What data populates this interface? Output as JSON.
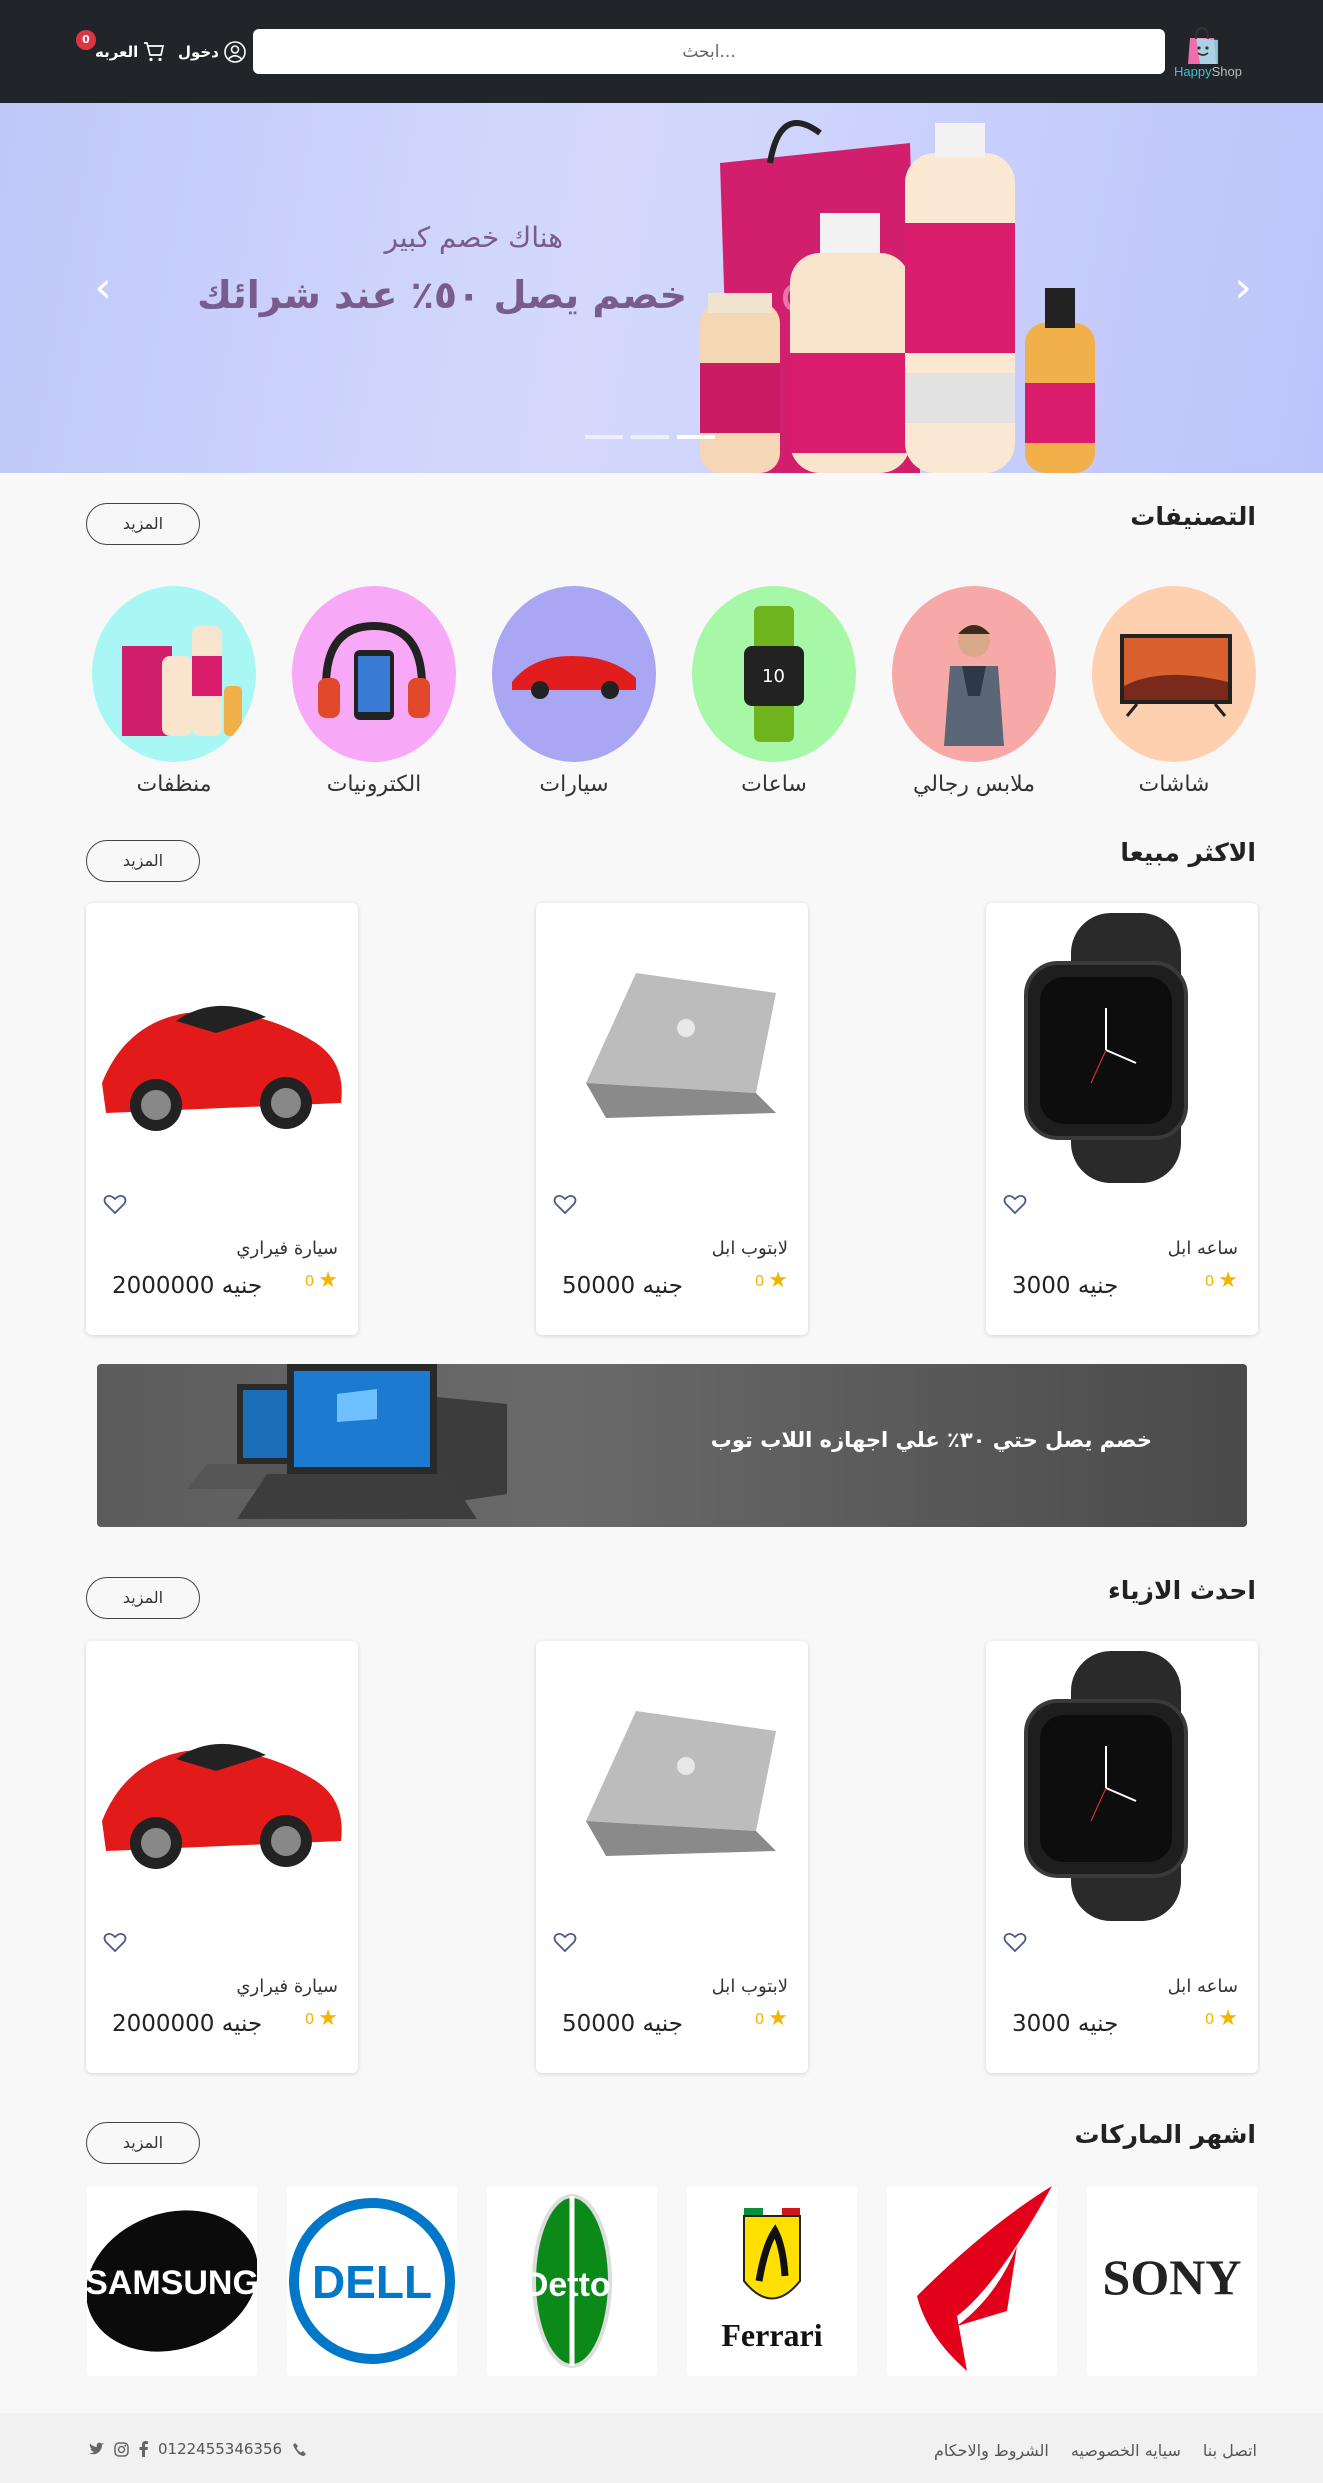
{
  "header": {
    "brand_part1": "Happy",
    "brand_part2": "Shop",
    "search_placeholder": "ابحث...",
    "login_label": "دخول",
    "cart_label": "العربه",
    "cart_count": "0"
  },
  "hero": {
    "subtitle": "هناك خصم كبير",
    "title": "خصم يصل ٥٠٪ عند شرائك",
    "slides_total": 3,
    "active_slide": 3
  },
  "categories": {
    "title": "التصنيفات",
    "more_label": "المزيد",
    "items": [
      {
        "label": "شاشات",
        "color": "#ffd0b0"
      },
      {
        "label": "ملابس رجالي",
        "color": "#f7a9a8"
      },
      {
        "label": "ساعات",
        "color": "#a6f7a6"
      },
      {
        "label": "سيارات",
        "color": "#a9a6f4"
      },
      {
        "label": "الكترونيات",
        "color": "#f7a9f7"
      },
      {
        "label": "منظفات",
        "color": "#a9f7f4"
      }
    ]
  },
  "best_sellers": {
    "title": "الاكثر مبيعا",
    "more_label": "المزيد",
    "products": [
      {
        "name": "ساعه ابل",
        "rating": "0",
        "price": "3000",
        "currency": "جنيه",
        "icon": "watch"
      },
      {
        "name": "لابتوب ابل",
        "rating": "0",
        "price": "50000",
        "currency": "جنيه",
        "icon": "laptop"
      },
      {
        "name": "سيارة فيراري",
        "rating": "0",
        "price": "2000000",
        "currency": "جنيه",
        "icon": "car"
      }
    ]
  },
  "promo": {
    "text": "خصم يصل حتي ٣٠٪ علي اجهازه اللاب توب"
  },
  "latest_fashion": {
    "title": "احدث الازياء",
    "more_label": "المزيد",
    "products": [
      {
        "name": "ساعه ابل",
        "rating": "0",
        "price": "3000",
        "currency": "جنيه",
        "icon": "watch"
      },
      {
        "name": "لابتوب ابل",
        "rating": "0",
        "price": "50000",
        "currency": "جنيه",
        "icon": "laptop"
      },
      {
        "name": "سيارة فيراري",
        "rating": "0",
        "price": "2000000",
        "currency": "جنيه",
        "icon": "car"
      }
    ]
  },
  "brands": {
    "title": "اشهر الماركات",
    "more_label": "المزيد",
    "items": [
      "SONY",
      "ROG",
      "Ferrari",
      "Dettol",
      "DELL",
      "SAMSUNG"
    ]
  },
  "footer": {
    "links": [
      "الشروط والاحكام",
      "سيايه الخصوصيه",
      "اتصل بنا"
    ],
    "phone": "0122455346356"
  }
}
